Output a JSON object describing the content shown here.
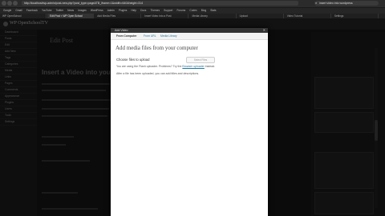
{
  "browser": {
    "url": "http://localhost/wp-admin/post-new.php?post_type=page&TB_iframe=1&width=640&height=314",
    "search": "insert video into wordpress",
    "bookmarks": [
      "Google",
      "Gmail",
      "Facebook",
      "YouTube",
      "Twitter",
      "News",
      "Images",
      "WordPress",
      "Admin",
      "Plugins",
      "Help",
      "Docs",
      "Themes",
      "Support",
      "Forums",
      "Codex",
      "Blog",
      "Stats"
    ],
    "tabs": [
      "WP OpenSchool",
      "Edit Post < WP Open School",
      "Add Media Files",
      "Insert Video Into a Post",
      "Media Library",
      "Upload",
      "Video Tutorial",
      "Settings"
    ]
  },
  "header": {
    "site_title": "WP OpenSchoolTV"
  },
  "sidebar": {
    "items": [
      "Dashboard",
      "Posts",
      "Edit",
      "Add New",
      "Tags",
      "Categories",
      "Media",
      "Links",
      "Pages",
      "Comments",
      "Appearance",
      "Plugins",
      "Users",
      "Tools",
      "Settings"
    ]
  },
  "background": {
    "page_title": "Edit Post",
    "post_title": "Insert a Video into your blog"
  },
  "modal": {
    "title": "Add Video",
    "close": "✕",
    "tabs": [
      "From Computer",
      "From URL",
      "Media Library"
    ],
    "heading": "Add media files from your computer",
    "choose_label": "Choose files to upload",
    "select_button": "Select Files",
    "help_prefix": "You are using the Flash uploader. Problems? Try the",
    "help_link": "Browser uploader",
    "help_suffix": "instead.",
    "after_upload": "After a file has been uploaded, you can add titles and descriptions."
  }
}
